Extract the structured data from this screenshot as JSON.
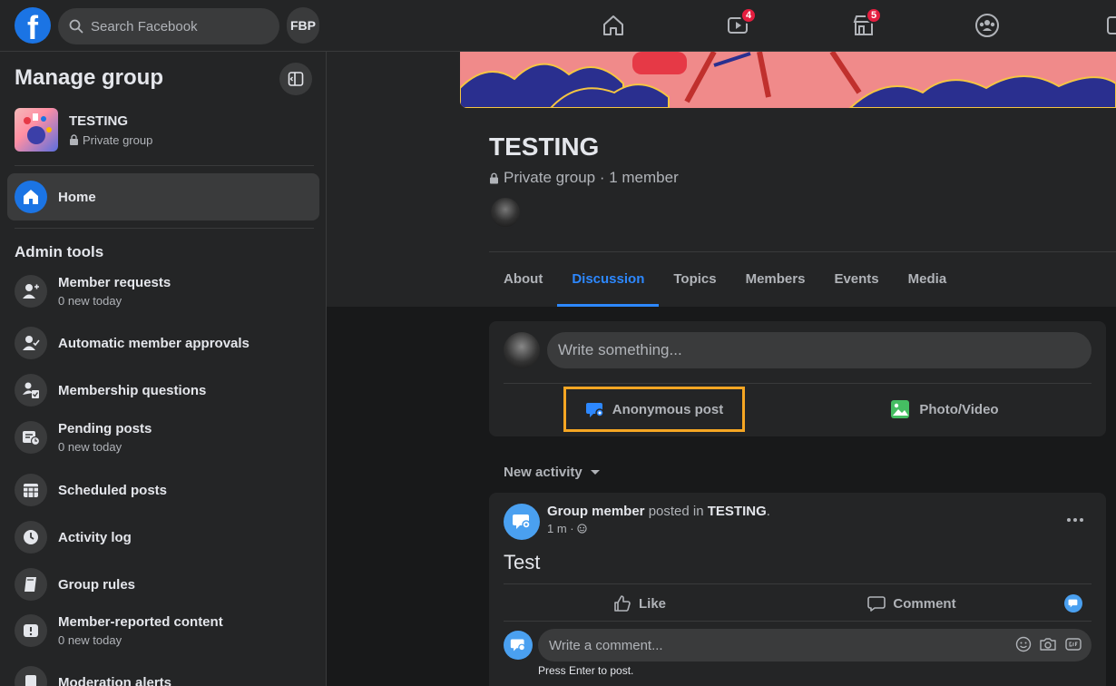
{
  "topbar": {
    "logo": "f",
    "search_placeholder": "Search Facebook",
    "profile_short": "FBP",
    "nav": [
      {
        "icon": "home-icon"
      },
      {
        "icon": "watch-icon",
        "badge": "4"
      },
      {
        "icon": "marketplace-icon",
        "badge": "5"
      },
      {
        "icon": "groups-icon"
      },
      {
        "icon": "gaming-icon"
      }
    ]
  },
  "sidebar": {
    "title": "Manage group",
    "group_name": "TESTING",
    "group_type": "Private group",
    "home_label": "Home",
    "admin_title": "Admin tools",
    "admin_items": [
      {
        "label": "Member requests",
        "sub": "0 new today"
      },
      {
        "label": "Automatic member approvals"
      },
      {
        "label": "Membership questions"
      },
      {
        "label": "Pending posts",
        "sub": "0 new today"
      },
      {
        "label": "Scheduled posts"
      },
      {
        "label": "Activity log"
      },
      {
        "label": "Group rules"
      },
      {
        "label": "Member-reported content",
        "sub": "0 new today"
      },
      {
        "label": "Moderation alerts"
      }
    ]
  },
  "group": {
    "title": "TESTING",
    "meta": "Private group · 1 member",
    "tabs": [
      "About",
      "Discussion",
      "Topics",
      "Members",
      "Events",
      "Media"
    ],
    "active_tab": "Discussion"
  },
  "composer": {
    "placeholder": "Write something...",
    "anon_label": "Anonymous post",
    "photo_label": "Photo/Video"
  },
  "feed": {
    "sort_label": "New activity"
  },
  "post": {
    "author": "Group member",
    "verb": " posted in ",
    "group": "TESTING",
    "tail": ".",
    "time": "1 m ·",
    "text": "Test",
    "like_label": "Like",
    "comment_label": "Comment",
    "comment_placeholder": "Write a comment...",
    "hint": "Press Enter to post."
  },
  "colors": {
    "accent": "#2d88ff",
    "highlight": "#f5a623",
    "badge": "#e41e3f"
  }
}
